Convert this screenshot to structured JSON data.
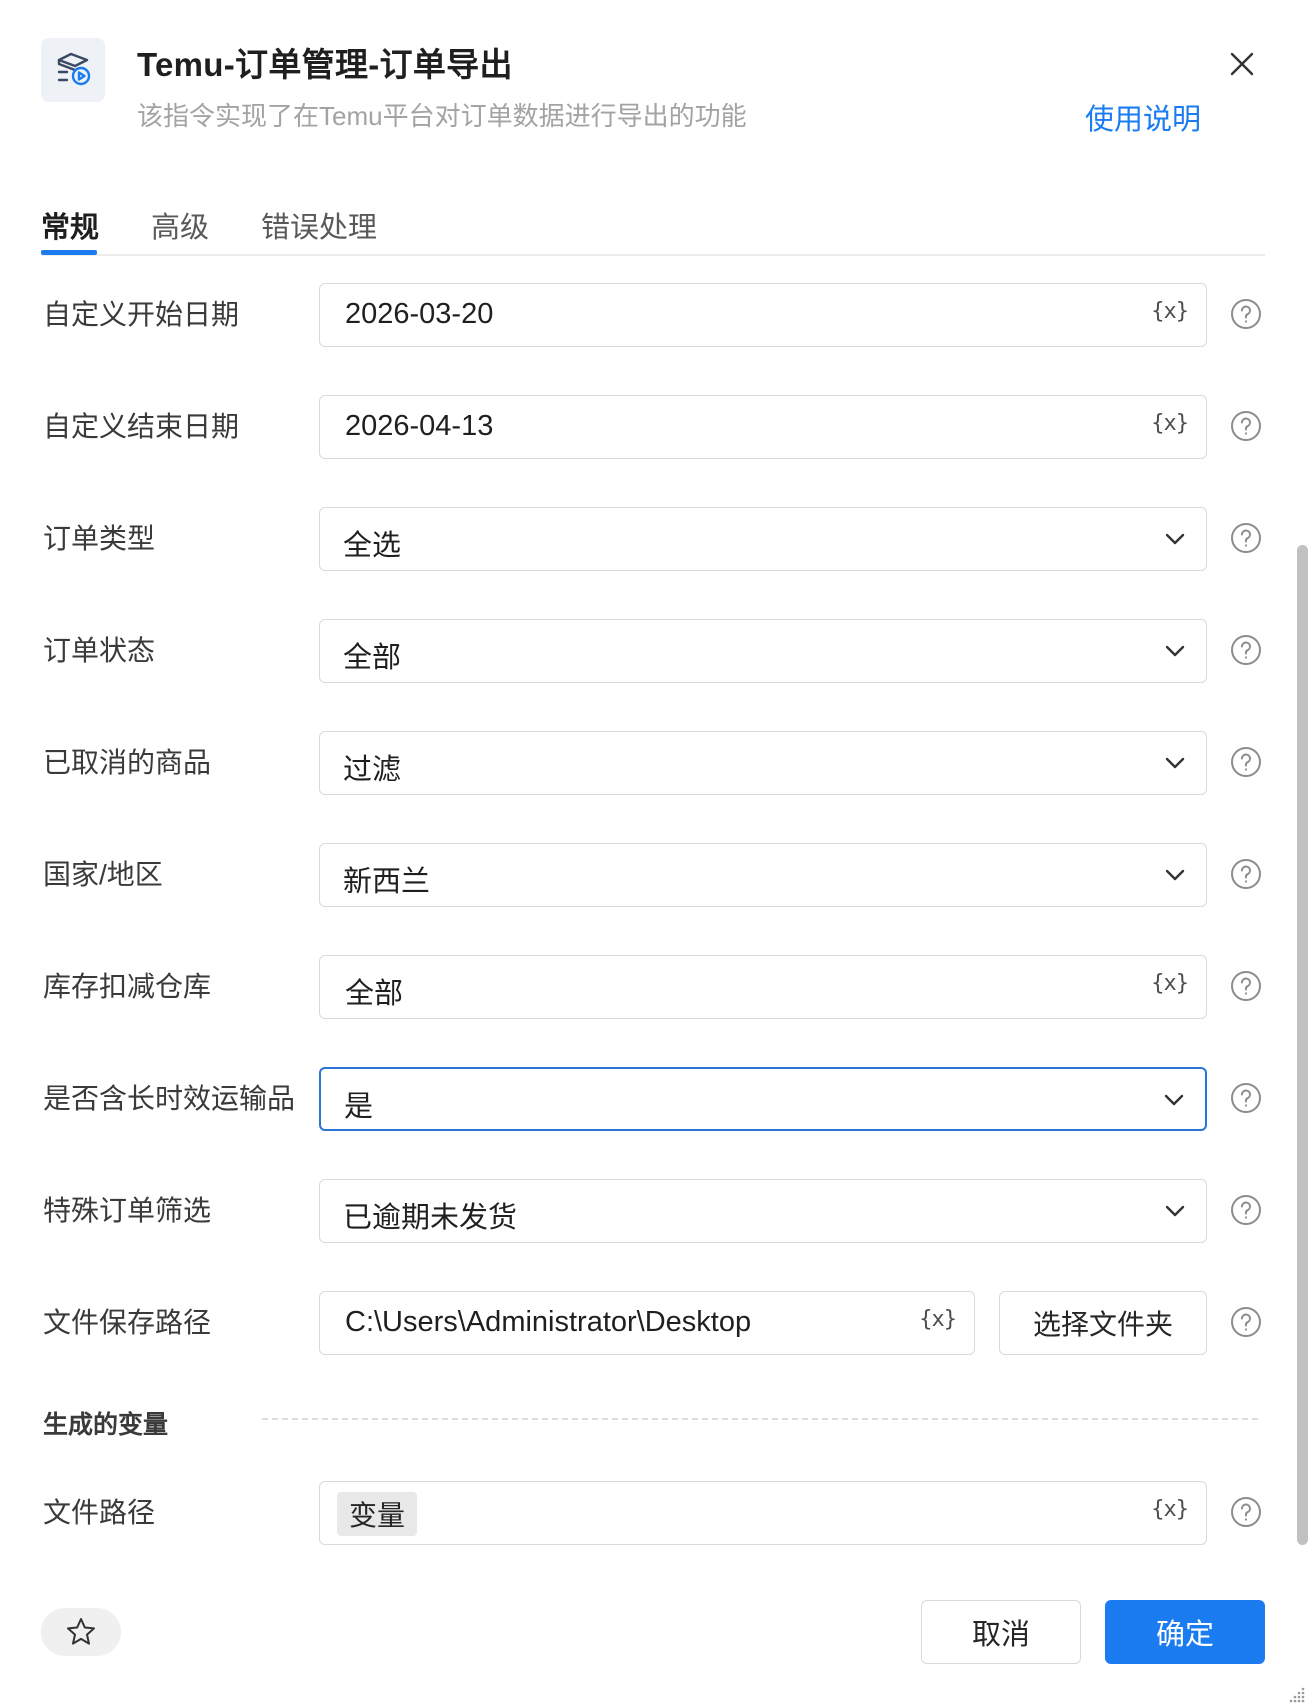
{
  "header": {
    "title": "Temu-订单管理-订单导出",
    "subtitle": "该指令实现了在Temu平台对订单数据进行导出的功能",
    "help_link": "使用说明",
    "icon": "app-logo-icon",
    "close_icon": "close-icon"
  },
  "tabs": [
    {
      "label": "常规",
      "active": true
    },
    {
      "label": "高级",
      "active": false
    },
    {
      "label": "错误处理",
      "active": false
    }
  ],
  "form": {
    "start_date": {
      "label": "自定义开始日期",
      "value": "2026-03-20",
      "var_symbol": "{x}"
    },
    "end_date": {
      "label": "自定义结束日期",
      "value": "2026-04-13",
      "var_symbol": "{x}"
    },
    "order_type": {
      "label": "订单类型",
      "value": "全选"
    },
    "order_status": {
      "label": "订单状态",
      "value": "全部"
    },
    "cancelled_items": {
      "label": "已取消的商品",
      "value": "过滤"
    },
    "country_region": {
      "label": "国家/地区",
      "value": "新西兰"
    },
    "stock_warehouse": {
      "label": "库存扣减仓库",
      "value": "全部",
      "var_symbol": "{x}"
    },
    "long_transit": {
      "label": "是否含长时效运输品",
      "value": "是"
    },
    "special_filter": {
      "label": "特殊订单筛选",
      "value": "已逾期未发货"
    },
    "save_path": {
      "label": "文件保存路径",
      "value": "C:\\Users\\Administrator\\Desktop",
      "var_symbol": "{x}",
      "button": "选择文件夹"
    }
  },
  "generated": {
    "section_title": "生成的变量",
    "file_path": {
      "label": "文件路径",
      "tag": "变量",
      "var_symbol": "{x}"
    }
  },
  "footer": {
    "cancel": "取消",
    "ok": "确定",
    "favorite_icon": "star-icon"
  },
  "colors": {
    "accent": "#1a7cf0",
    "focus_border": "#2a73d9",
    "border": "#d9d9d9",
    "muted_text": "#a3a3a3"
  }
}
